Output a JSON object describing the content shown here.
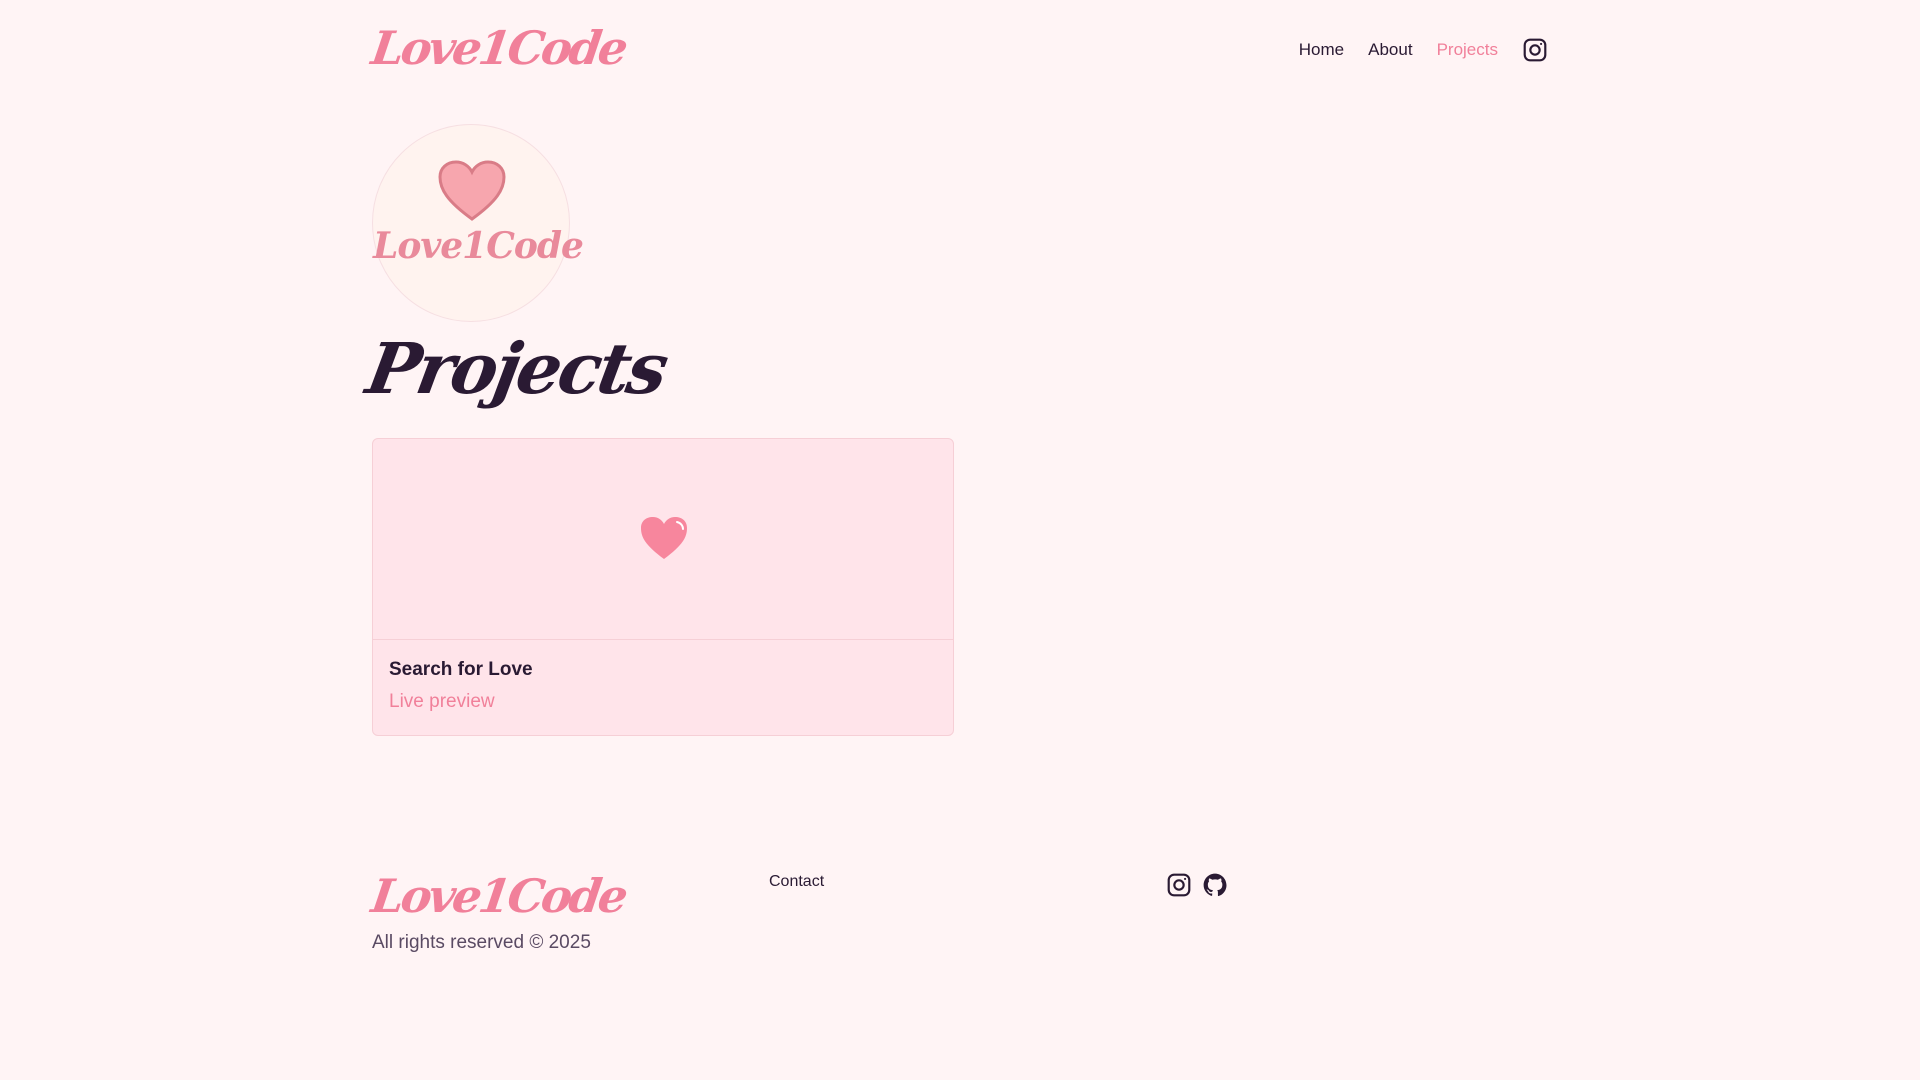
{
  "header": {
    "brand": "Love1Code",
    "nav": [
      {
        "label": "Home"
      },
      {
        "label": "About"
      },
      {
        "label": "Projects",
        "active": true
      }
    ],
    "social_icon": "instagram-icon"
  },
  "logo": {
    "text": "Love1Code",
    "icon": "heart-icon"
  },
  "main": {
    "title": "Projects",
    "projects": [
      {
        "title": "Search for Love",
        "link_label": "Live preview",
        "icon": "heart-icon"
      }
    ]
  },
  "footer": {
    "brand": "Love1Code",
    "copyright": "All rights reserved © 2025",
    "contact_label": "Contact",
    "icons": [
      "instagram-icon",
      "github-icon"
    ]
  },
  "colors": {
    "background": "#fff4f5",
    "accent": "#f1809a",
    "text": "#2a1a33",
    "card": "#ffe4ea"
  }
}
